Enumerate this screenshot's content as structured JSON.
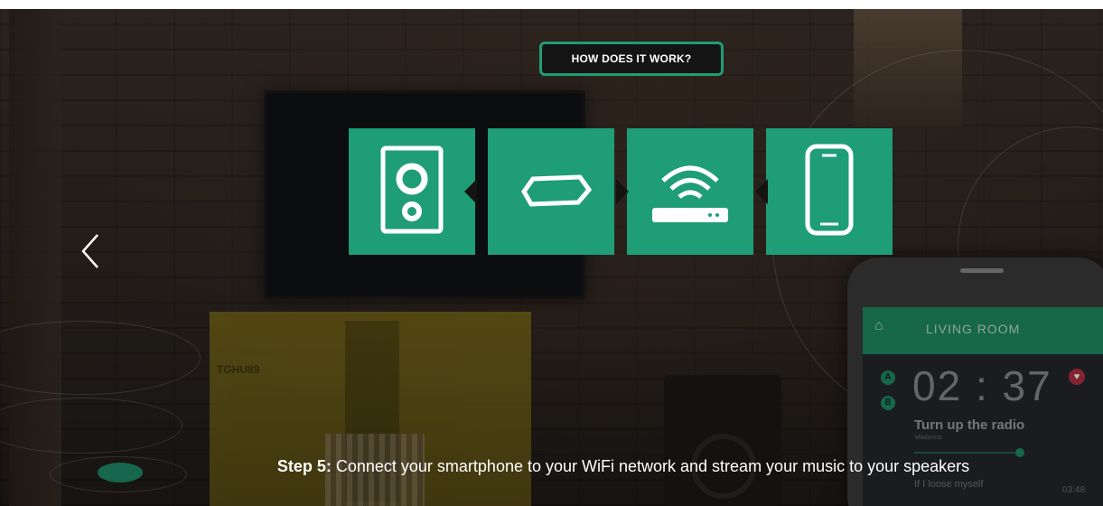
{
  "hero": {
    "title_button_label": "HOW DOES IT WORK?"
  },
  "steps": {
    "items": [
      {
        "icon": "speaker-icon"
      },
      {
        "icon": "hub-icon"
      },
      {
        "icon": "wifi-router-icon"
      },
      {
        "icon": "smartphone-icon"
      }
    ]
  },
  "caption": {
    "step_label": "Step 5:",
    "text": " Connect your smartphone to your WiFi network and stream your music to your speakers"
  },
  "background_phone": {
    "room_label": "LIVING ROOM",
    "clock": "02 : 37",
    "song_title": "Turn up the radio",
    "song_artist": "Madonna",
    "next_song": "If I loose myself",
    "next_time": "03:48",
    "badge_a": "A",
    "badge_b": "B"
  },
  "background_decor": {
    "cabinet_letters": "TGHU89"
  },
  "colors": {
    "accent": "#1f9d77",
    "dark": "#141414",
    "text": "#ffffff"
  }
}
